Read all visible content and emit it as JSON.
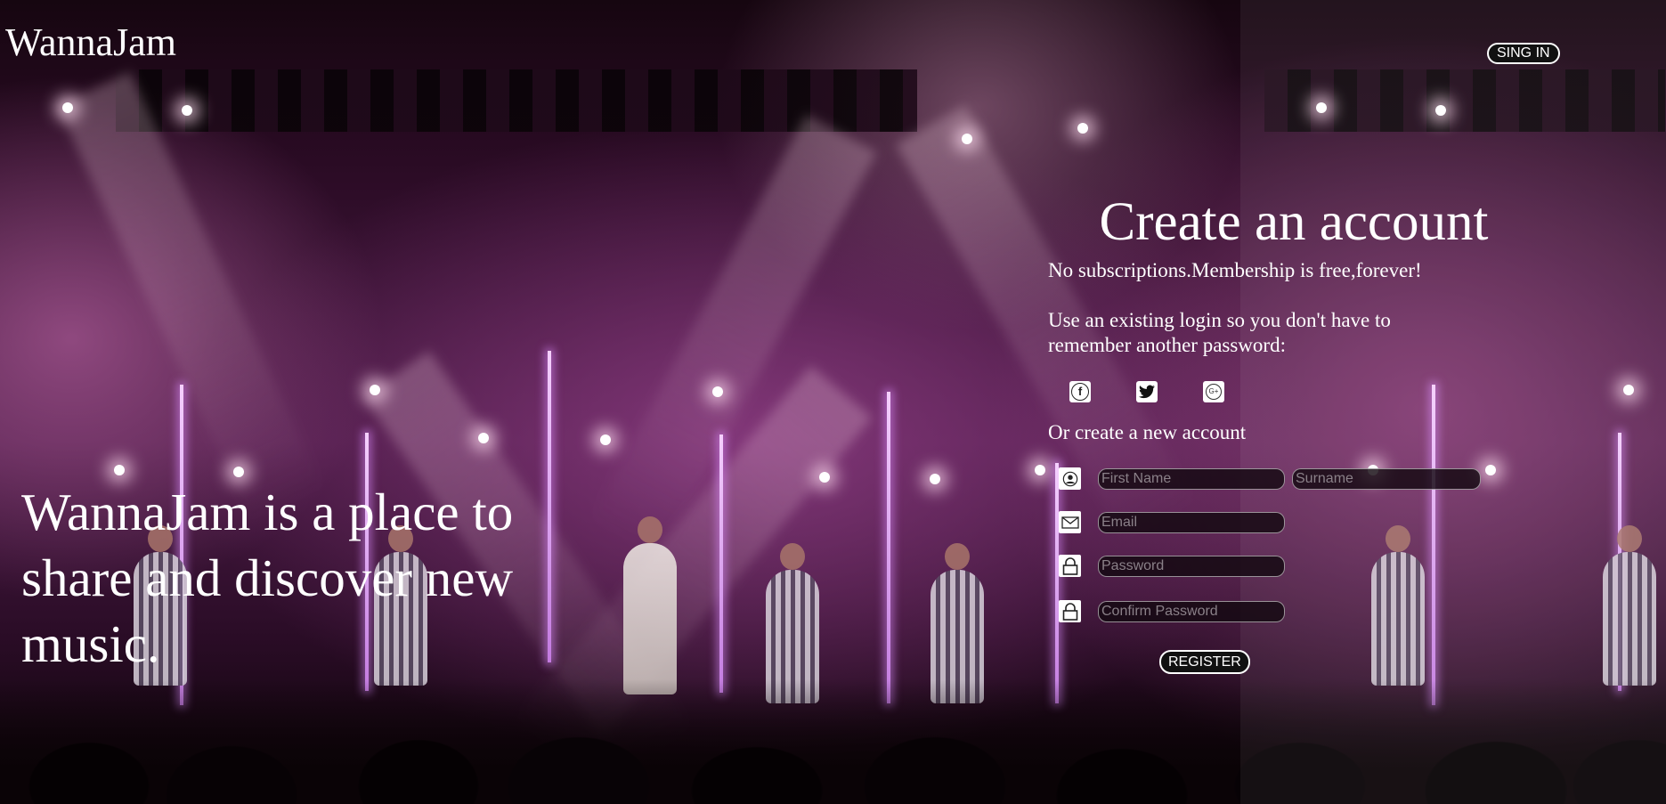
{
  "header": {
    "logo": "WannaJam",
    "signin_label": "SING IN"
  },
  "hero": {
    "tagline": "WannaJam is a place to share and discover new music."
  },
  "register": {
    "title": "Create an account",
    "subtitle": "No subscriptions.Membership is free,forever!",
    "social_prompt": "Use an existing login so you don't have to remember another password:",
    "socials": [
      {
        "name": "facebook",
        "icon": "facebook-icon"
      },
      {
        "name": "twitter",
        "icon": "twitter-icon"
      },
      {
        "name": "google-plus",
        "icon": "google-plus-icon"
      }
    ],
    "or_text": "Or create a new account",
    "fields": {
      "first_name": {
        "placeholder": "First Name",
        "value": ""
      },
      "surname": {
        "placeholder": "Surname",
        "value": ""
      },
      "email": {
        "placeholder": "Email",
        "value": ""
      },
      "password": {
        "placeholder": "Password",
        "value": ""
      },
      "confirm_password": {
        "placeholder": "Confirm Password",
        "value": ""
      }
    },
    "submit_label": "REGISTER"
  },
  "colors": {
    "text": "#ffffff",
    "button_bg": "#111111",
    "input_bg": "#120810"
  }
}
